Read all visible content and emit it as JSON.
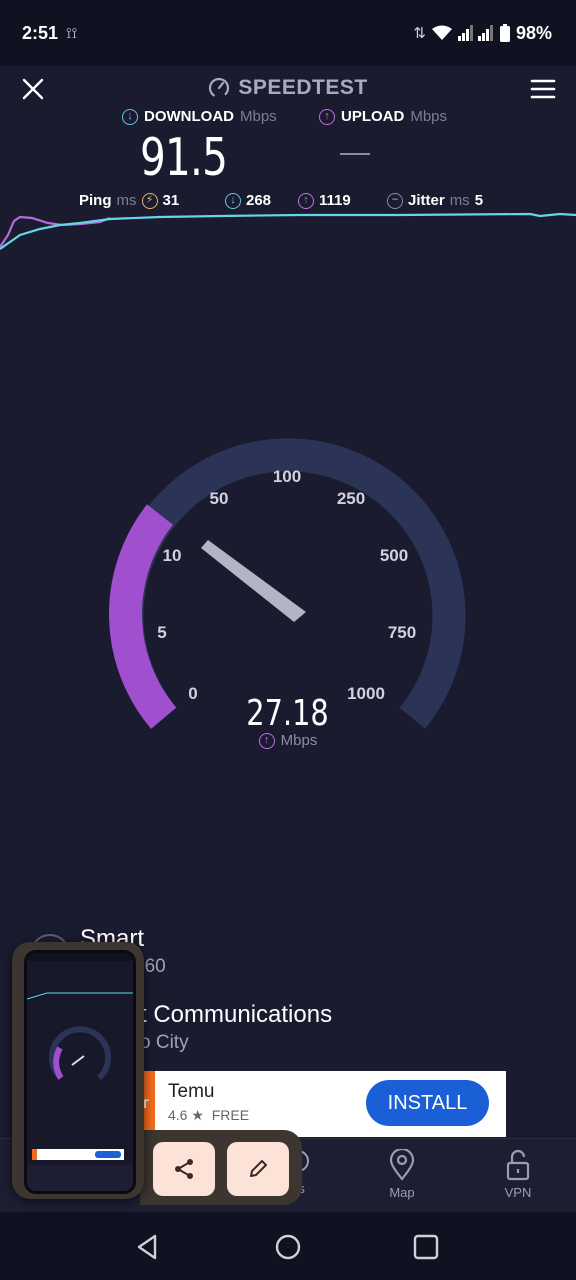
{
  "status_bar": {
    "time": "2:51",
    "battery": "98%"
  },
  "header": {
    "title": "SPEEDTEST"
  },
  "download": {
    "label": "DOWNLOAD",
    "unit": "Mbps",
    "value": "91.5"
  },
  "upload": {
    "label": "UPLOAD",
    "unit": "Mbps",
    "value": "—"
  },
  "stats": {
    "ping_label": "Ping",
    "ping_unit": "ms",
    "ping_value": "31",
    "down_latency": "268",
    "up_latency": "1119",
    "jitter_label": "Jitter",
    "jitter_unit": "ms",
    "jitter_value": "5"
  },
  "gauge": {
    "ticks": [
      "0",
      "5",
      "10",
      "50",
      "100",
      "250",
      "500",
      "750",
      "1000"
    ],
    "value": "27.18",
    "unit": "Mbps",
    "progress_fraction": 0.25
  },
  "isp": {
    "name": "Smart",
    "ip_partial": "760"
  },
  "server": {
    "name_partial": "t Communications",
    "location_partial": "o City"
  },
  "ad": {
    "name": "Temu",
    "rating": "4.6 ★",
    "price": "FREE",
    "install": "INSTALL"
  },
  "tabs": [
    {
      "label": "ds"
    },
    {
      "label": "Map"
    },
    {
      "label": "VPN"
    }
  ],
  "colors": {
    "background": "#1a1b2f",
    "download": "#5ec8e4",
    "upload": "#c071e6",
    "install": "#1a5fd6"
  }
}
